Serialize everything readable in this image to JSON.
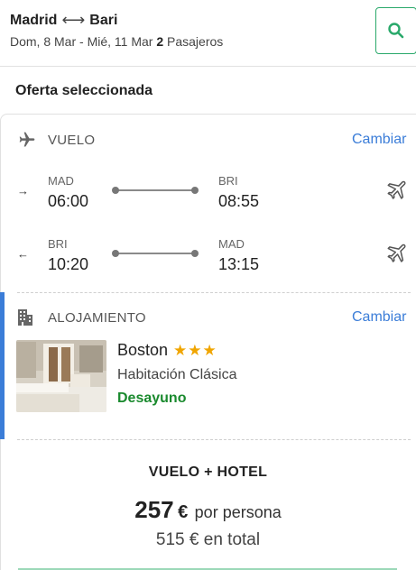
{
  "search": {
    "origin": "Madrid",
    "destination": "Bari",
    "dates": "Dom, 8 Mar - Mié, 11 Mar",
    "passengers_count": "2",
    "passengers_label": "Pasajeros"
  },
  "selected_offer": {
    "title": "Oferta seleccionada"
  },
  "flight": {
    "section_label": "VUELO",
    "change_label": "Cambiar",
    "legs": [
      {
        "direction": "→",
        "from_code": "MAD",
        "dep_time": "06:00",
        "to_code": "BRI",
        "arr_time": "08:55"
      },
      {
        "direction": "←",
        "from_code": "BRI",
        "dep_time": "10:20",
        "to_code": "MAD",
        "arr_time": "13:15"
      }
    ]
  },
  "accommodation": {
    "section_label": "ALOJAMIENTO",
    "change_label": "Cambiar",
    "hotel_name": "Boston",
    "stars": "★★★",
    "room_type": "Habitación Clásica",
    "board": "Desayuno"
  },
  "package": {
    "title": "VUELO + HOTEL",
    "price_per_person": "257",
    "currency": "€",
    "per_person_label": "por persona",
    "total_price": "515",
    "total_label": "en total"
  },
  "colors": {
    "accent": "#3b7dd8",
    "green": "#2aa96b",
    "board_green": "#1a8a2e",
    "star": "#f0a500"
  }
}
